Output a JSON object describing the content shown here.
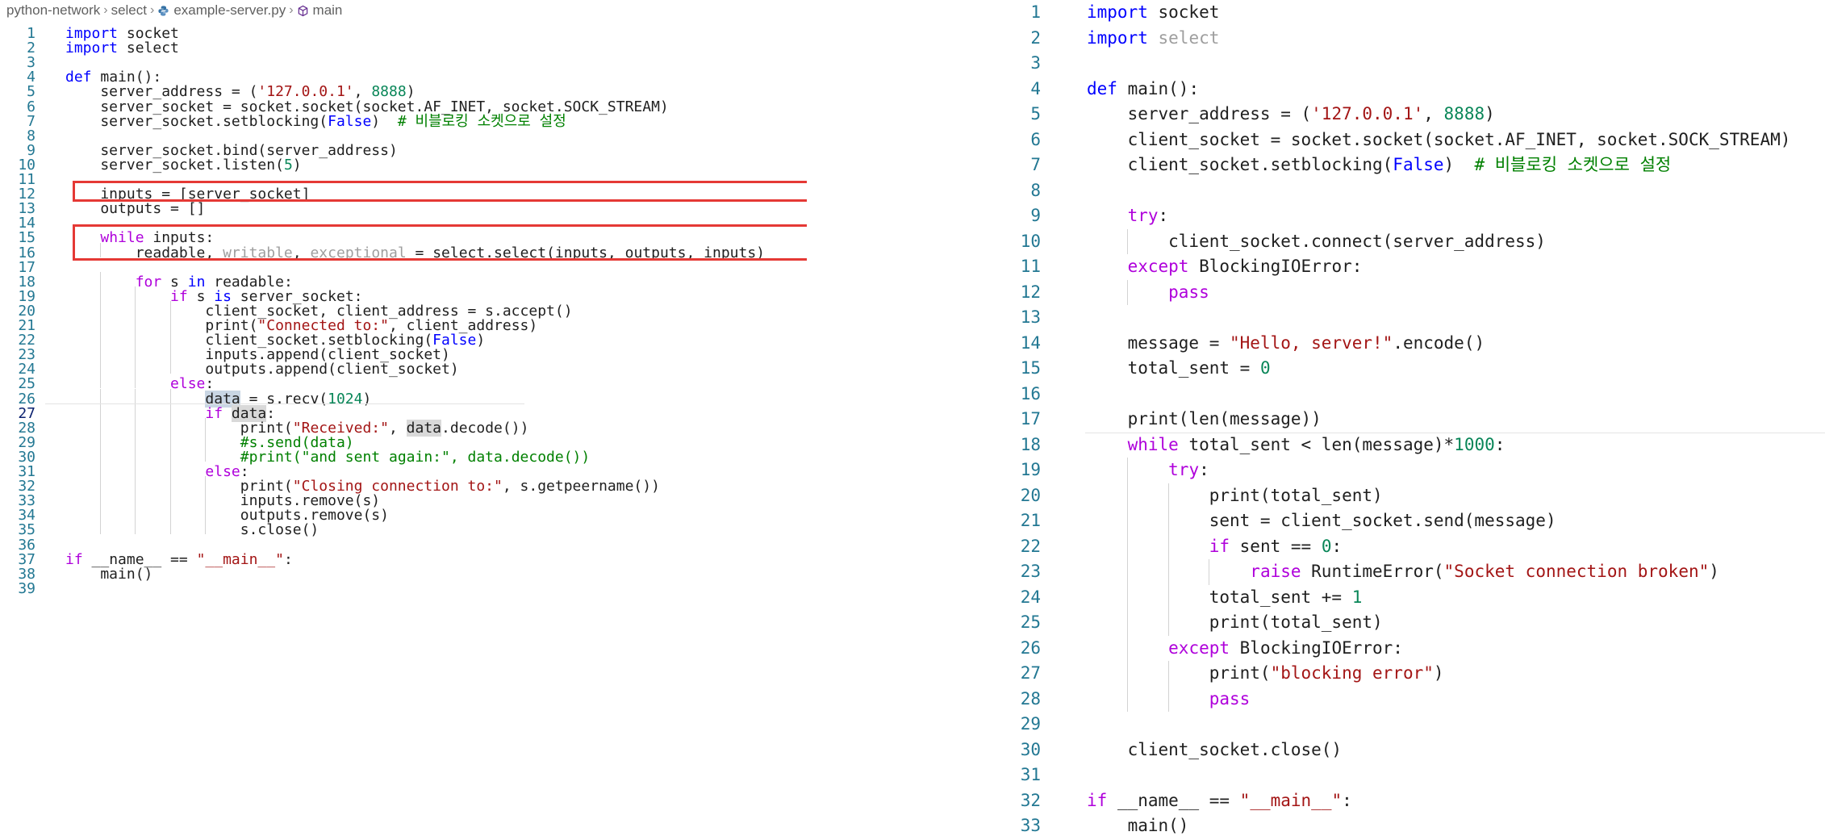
{
  "breadcrumb": {
    "items": [
      "python-network",
      "select",
      "example-server.py",
      "main"
    ]
  },
  "colors": {
    "keyword": "#0000ff",
    "control": "#af00db",
    "string": "#a31515",
    "number": "#098658",
    "comment": "#008000",
    "line_number": "#237893",
    "highlight_box": "#e53935"
  },
  "left_editor": {
    "active_line": 27,
    "highlighted_lines": [
      [
        12,
        12
      ],
      [
        15,
        16
      ]
    ],
    "lines": [
      {
        "n": "1",
        "code": "import socket"
      },
      {
        "n": "2",
        "code": "import select"
      },
      {
        "n": "3",
        "code": ""
      },
      {
        "n": "4",
        "code": "def main():"
      },
      {
        "n": "5",
        "code": "    server_address = ('127.0.0.1', 8888)"
      },
      {
        "n": "6",
        "code": "    server_socket = socket.socket(socket.AF_INET, socket.SOCK_STREAM)"
      },
      {
        "n": "7",
        "code": "    server_socket.setblocking(False)  # 비블로킹 소켓으로 설정"
      },
      {
        "n": "8",
        "code": ""
      },
      {
        "n": "9",
        "code": "    server_socket.bind(server_address)"
      },
      {
        "n": "10",
        "code": "    server_socket.listen(5)"
      },
      {
        "n": "11",
        "code": ""
      },
      {
        "n": "12",
        "code": "    inputs = [server_socket]"
      },
      {
        "n": "13",
        "code": "    outputs = []"
      },
      {
        "n": "14",
        "code": ""
      },
      {
        "n": "15",
        "code": "    while inputs:"
      },
      {
        "n": "16",
        "code": "        readable, writable, exceptional = select.select(inputs, outputs, inputs)"
      },
      {
        "n": "17",
        "code": ""
      },
      {
        "n": "18",
        "code": "        for s in readable:"
      },
      {
        "n": "19",
        "code": "            if s is server_socket:"
      },
      {
        "n": "20",
        "code": "                client_socket, client_address = s.accept()"
      },
      {
        "n": "21",
        "code": "                print(\"Connected to:\", client_address)"
      },
      {
        "n": "22",
        "code": "                client_socket.setblocking(False)"
      },
      {
        "n": "23",
        "code": "                inputs.append(client_socket)"
      },
      {
        "n": "24",
        "code": "                outputs.append(client_socket)"
      },
      {
        "n": "25",
        "code": "            else:"
      },
      {
        "n": "26",
        "code": "                data = s.recv(1024)"
      },
      {
        "n": "27",
        "code": "                if data:"
      },
      {
        "n": "28",
        "code": "                    print(\"Received:\", data.decode())"
      },
      {
        "n": "29",
        "code": "                    #s.send(data)"
      },
      {
        "n": "30",
        "code": "                    #print(\"and sent again:\", data.decode())"
      },
      {
        "n": "31",
        "code": "                else:"
      },
      {
        "n": "32",
        "code": "                    print(\"Closing connection to:\", s.getpeername())"
      },
      {
        "n": "33",
        "code": "                    inputs.remove(s)"
      },
      {
        "n": "34",
        "code": "                    outputs.remove(s)"
      },
      {
        "n": "35",
        "code": "                    s.close()"
      },
      {
        "n": "36",
        "code": ""
      },
      {
        "n": "37",
        "code": "if __name__ == \"__main__\":"
      },
      {
        "n": "38",
        "code": "    main()"
      },
      {
        "n": "39",
        "code": ""
      }
    ]
  },
  "right_editor": {
    "active_line": 18,
    "lines": [
      {
        "n": "1",
        "code": "import socket"
      },
      {
        "n": "2",
        "code": "import select"
      },
      {
        "n": "3",
        "code": ""
      },
      {
        "n": "4",
        "code": "def main():"
      },
      {
        "n": "5",
        "code": "    server_address = ('127.0.0.1', 8888)"
      },
      {
        "n": "6",
        "code": "    client_socket = socket.socket(socket.AF_INET, socket.SOCK_STREAM)"
      },
      {
        "n": "7",
        "code": "    client_socket.setblocking(False)  # 비블로킹 소켓으로 설정"
      },
      {
        "n": "8",
        "code": ""
      },
      {
        "n": "9",
        "code": "    try:"
      },
      {
        "n": "10",
        "code": "        client_socket.connect(server_address)"
      },
      {
        "n": "11",
        "code": "    except BlockingIOError:"
      },
      {
        "n": "12",
        "code": "        pass"
      },
      {
        "n": "13",
        "code": ""
      },
      {
        "n": "14",
        "code": "    message = \"Hello, server!\".encode()"
      },
      {
        "n": "15",
        "code": "    total_sent = 0"
      },
      {
        "n": "16",
        "code": ""
      },
      {
        "n": "17",
        "code": "    print(len(message))"
      },
      {
        "n": "18",
        "code": "    while total_sent < len(message)*1000:"
      },
      {
        "n": "19",
        "code": "        try:"
      },
      {
        "n": "20",
        "code": "            print(total_sent)"
      },
      {
        "n": "21",
        "code": "            sent = client_socket.send(message)"
      },
      {
        "n": "22",
        "code": "            if sent == 0:"
      },
      {
        "n": "23",
        "code": "                raise RuntimeError(\"Socket connection broken\")"
      },
      {
        "n": "24",
        "code": "            total_sent += 1"
      },
      {
        "n": "25",
        "code": "            print(total_sent)"
      },
      {
        "n": "26",
        "code": "        except BlockingIOError:"
      },
      {
        "n": "27",
        "code": "            print(\"blocking error\")"
      },
      {
        "n": "28",
        "code": "            pass"
      },
      {
        "n": "29",
        "code": ""
      },
      {
        "n": "30",
        "code": "    client_socket.close()"
      },
      {
        "n": "31",
        "code": ""
      },
      {
        "n": "32",
        "code": "if __name__ == \"__main__\":"
      },
      {
        "n": "33",
        "code": "    main()"
      }
    ]
  }
}
